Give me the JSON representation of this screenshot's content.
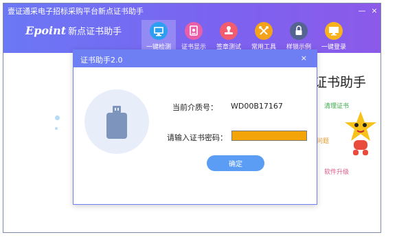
{
  "window": {
    "title": "壹证通采电子招标采购平台新点证书助手",
    "minimize": "—",
    "close": "×"
  },
  "logo": {
    "brand": "Epoint",
    "name": "新点证书助手"
  },
  "toolbar": [
    {
      "label": "一键检测",
      "icon": "monitor-icon",
      "color": "#2d9ef0",
      "active": true
    },
    {
      "label": "证书显示",
      "icon": "certificate-icon",
      "color": "#e95ea8",
      "active": false
    },
    {
      "label": "签章测试",
      "icon": "stamp-icon",
      "color": "#f25c6e",
      "active": false
    },
    {
      "label": "常用工具",
      "icon": "tools-icon",
      "color": "#f5a21b",
      "active": false
    },
    {
      "label": "样锁示例",
      "icon": "lock-icon",
      "color": "#54638f",
      "active": false
    },
    {
      "label": "一键登录",
      "icon": "login-screen-icon",
      "color": "#f7b21e",
      "active": false
    }
  ],
  "background": {
    "title_fragment": "证书助手",
    "features": [
      {
        "label": "清理证书",
        "color": "#3aa84a"
      },
      {
        "label": "问题",
        "color": "#e69a2f"
      },
      {
        "label": "软件升级",
        "color": "#e0588a"
      }
    ]
  },
  "dialog": {
    "title": "证书助手2.0",
    "close": "×",
    "media_label": "当前介质号：",
    "media_value": "WD00B17167",
    "password_label": "请输入证书密码：",
    "password_value": "",
    "confirm_label": "确定",
    "accent_color": "#6e7ff3",
    "input_fill_color": "#f2a408"
  }
}
